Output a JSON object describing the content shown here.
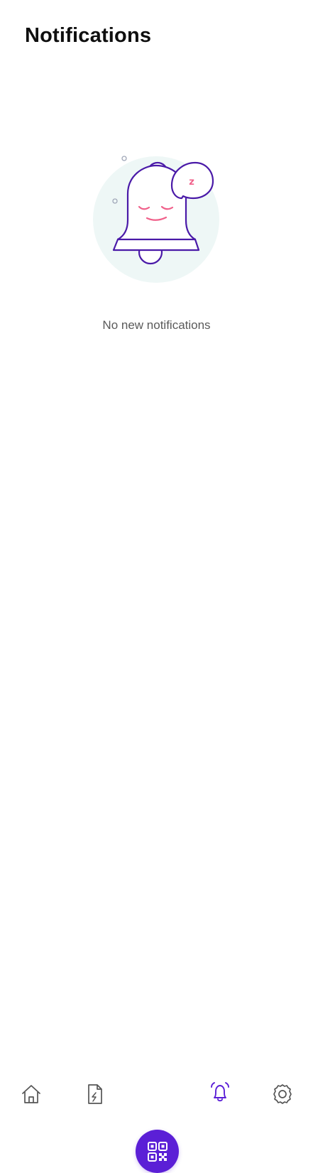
{
  "header": {
    "title": "Notifications"
  },
  "empty_state": {
    "illustration_icon": "sleeping-bell-icon",
    "snore_text": "z",
    "message": "No new notifications"
  },
  "bottom_nav": {
    "items": [
      {
        "icon": "home-icon",
        "active": false
      },
      {
        "icon": "document-icon",
        "active": false
      },
      {
        "icon": "qr-code-icon",
        "active": false
      },
      {
        "icon": "bell-icon",
        "active": true
      },
      {
        "icon": "gear-icon",
        "active": false
      }
    ]
  },
  "colors": {
    "accent": "#5b1fd6",
    "bell_stroke": "#4a1aa8",
    "face": "#f0608a",
    "background_circle": "#eef7f6",
    "icon_gray": "#555555",
    "message_text": "#5a5a5a"
  }
}
